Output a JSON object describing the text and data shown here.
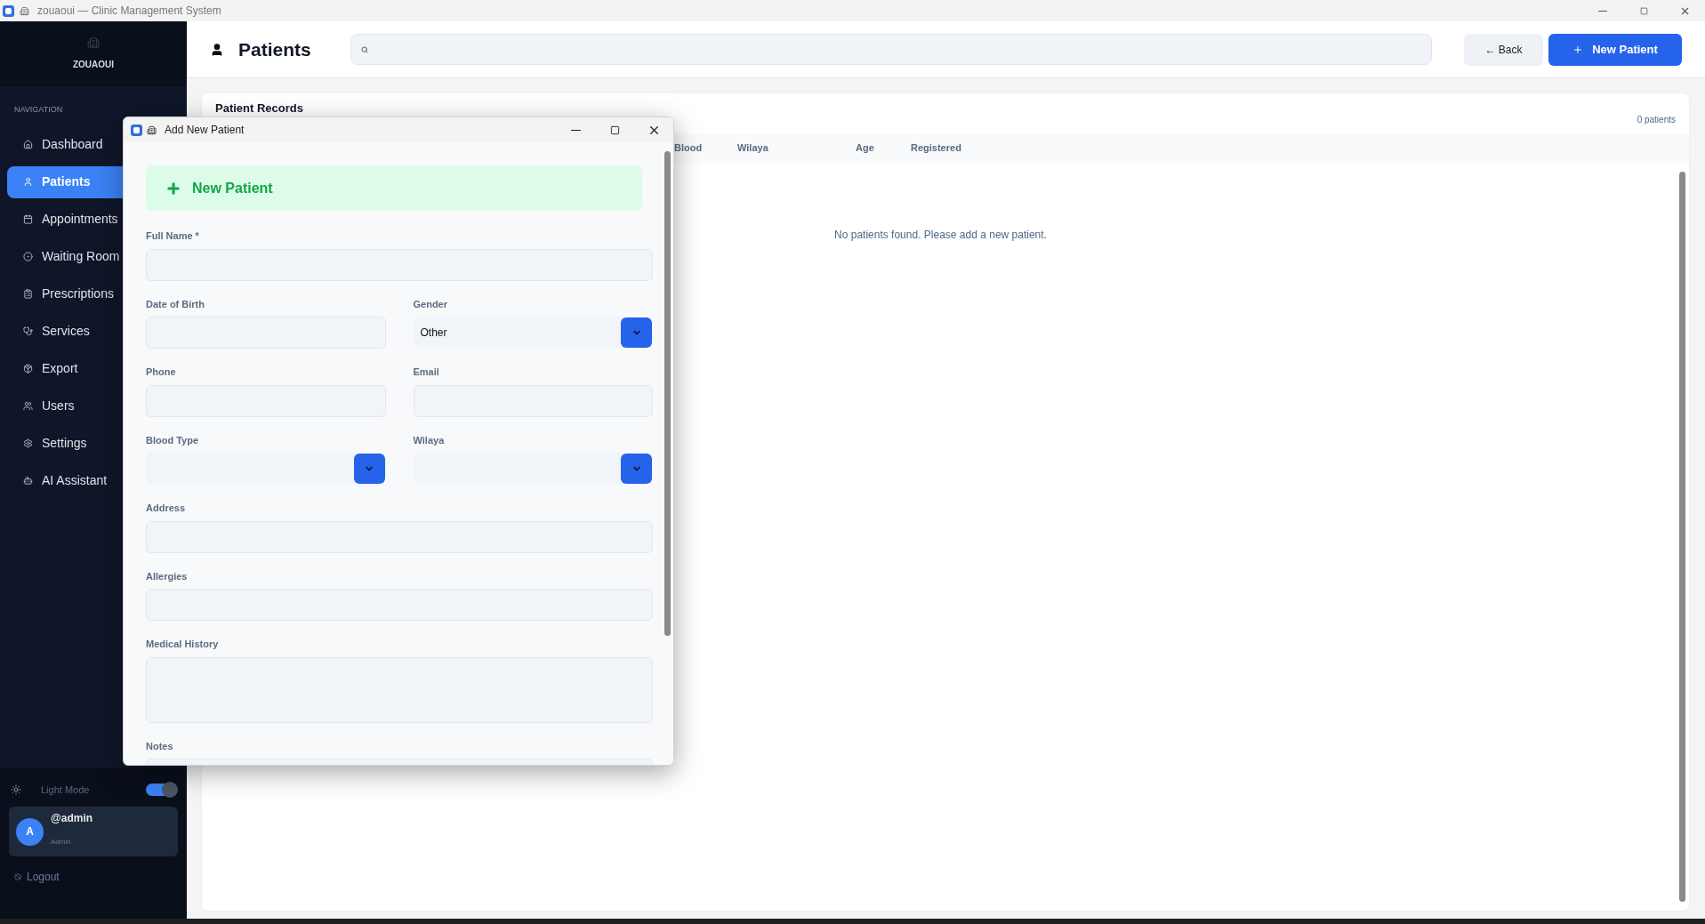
{
  "window": {
    "title": "zouaoui — Clinic Management System"
  },
  "sidebar": {
    "brand": "ZOUAOUI",
    "section": "NAVIGATION",
    "items": [
      {
        "label": "Dashboard",
        "selected": false
      },
      {
        "label": "Patients",
        "selected": true
      },
      {
        "label": "Appointments",
        "selected": false
      },
      {
        "label": "Waiting Room",
        "selected": false
      },
      {
        "label": "Prescriptions",
        "selected": false
      },
      {
        "label": "Services",
        "selected": false
      },
      {
        "label": "Export",
        "selected": false
      },
      {
        "label": "Users",
        "selected": false
      },
      {
        "label": "Settings",
        "selected": false
      },
      {
        "label": "AI Assistant",
        "selected": false
      }
    ],
    "theme": {
      "label": "Light Mode",
      "on": true
    },
    "user": {
      "avatar": "A",
      "name": "@admin",
      "role": "Admin"
    },
    "logout": "Logout"
  },
  "header": {
    "title": "Patients",
    "back": "← Back",
    "new": "New Patient"
  },
  "records": {
    "title": "Patient Records",
    "count": "0 patients",
    "columns": [
      "Blood",
      "Wilaya",
      "Age",
      "Registered"
    ],
    "empty": "No patients found. Please add a new patient."
  },
  "dialog": {
    "title": "Add New Patient",
    "heading": "New Patient",
    "rows": [
      [
        {
          "label": "Full Name *",
          "kind": "text"
        }
      ],
      [
        {
          "label": "Date of Birth",
          "kind": "text"
        },
        {
          "label": "Gender",
          "kind": "select",
          "value": "Other"
        }
      ],
      [
        {
          "label": "Phone",
          "kind": "text"
        },
        {
          "label": "Email",
          "kind": "text"
        }
      ],
      [
        {
          "label": "Blood Type",
          "kind": "select"
        },
        {
          "label": "Wilaya",
          "kind": "select"
        }
      ],
      [
        {
          "label": "Address",
          "kind": "text"
        }
      ],
      [
        {
          "label": "Allergies",
          "kind": "text"
        }
      ],
      [
        {
          "label": "Medical History",
          "kind": "textarea"
        }
      ],
      [
        {
          "label": "Notes",
          "kind": "text"
        }
      ]
    ]
  }
}
